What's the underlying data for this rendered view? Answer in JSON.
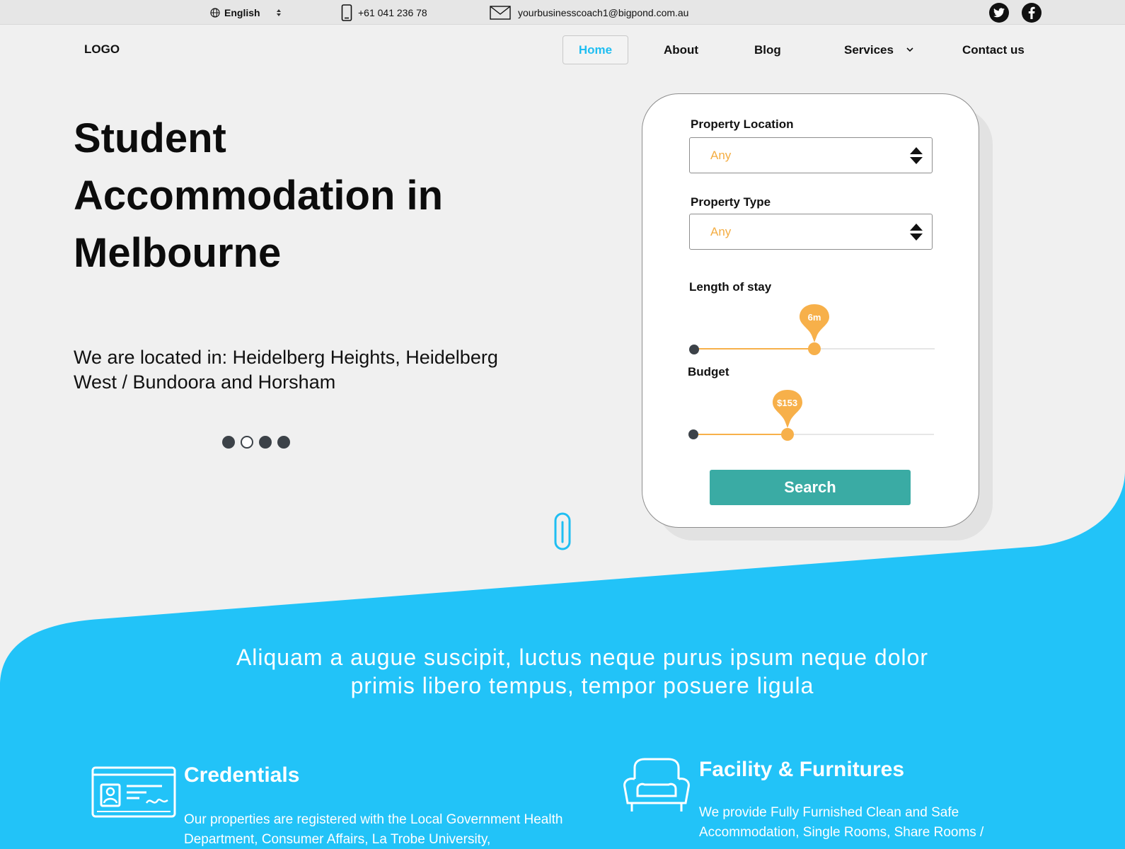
{
  "topbar": {
    "language": "English",
    "phone": "+61 041 236 78",
    "email": "yourbusinesscoach1@bigpond.com.au",
    "social": [
      "twitter-icon",
      "facebook-icon"
    ]
  },
  "nav": {
    "logo": "LOGO",
    "items": [
      {
        "label": "Home",
        "active": true
      },
      {
        "label": "About"
      },
      {
        "label": "Blog"
      },
      {
        "label": "Services",
        "has_dropdown": true
      },
      {
        "label": "Contact us"
      }
    ]
  },
  "hero": {
    "title": "Student Accommodation in Melbourne",
    "location_text": "We are located in: Heidelberg Heights, Heidelberg West / Bundoora and Horsham",
    "carousel": {
      "count": 4,
      "active_index": 1
    }
  },
  "search_form": {
    "location": {
      "label": "Property Location",
      "value": "Any"
    },
    "type": {
      "label": "Property Type",
      "value": "Any"
    },
    "stay": {
      "label": "Length of stay",
      "value_label": "6m",
      "fraction": 0.5
    },
    "budget": {
      "label": "Budget",
      "value_label": "$153",
      "fraction": 0.39
    },
    "button": "Search"
  },
  "section": {
    "tagline": "Aliquam a augue suscipit, luctus neque purus ipsum neque dolor primis libero tempus, tempor posuere ligula",
    "features": [
      {
        "title": "Credentials",
        "text": "Our properties are registered with the Local Government Health Department, Consumer Affairs, La Trobe University,",
        "icon": "id-card-icon"
      },
      {
        "title": "Facility & Furnitures",
        "text": "We provide Fully Furnished Clean and Safe Accommodation, Single Rooms, Share Rooms /",
        "icon": "armchair-icon"
      }
    ]
  },
  "colors": {
    "accent_blue": "#22c3f8",
    "slider_orange": "#f7b04a",
    "button_teal": "#3aaba4"
  }
}
